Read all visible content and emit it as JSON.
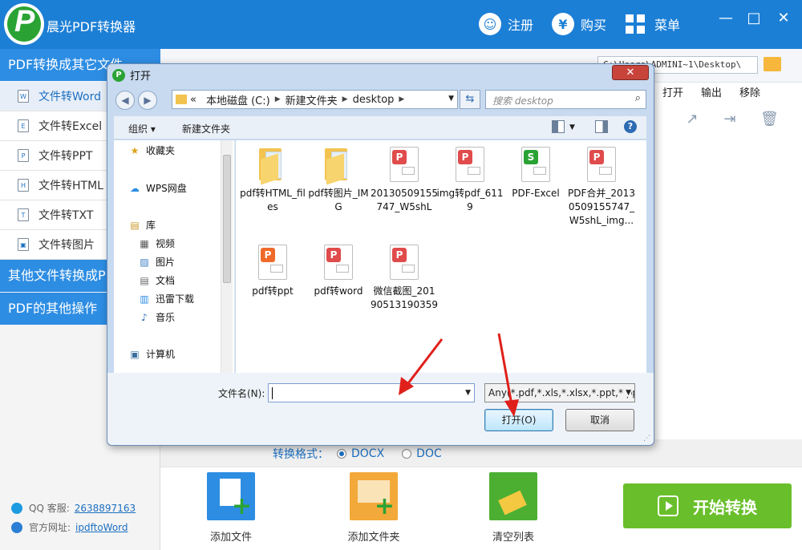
{
  "app": {
    "title": "晨光PDF转换器",
    "register": "注册",
    "buy": "购买",
    "menu": "菜单",
    "buy_symbol": "¥",
    "win_controls": [
      "—",
      "□",
      "✕"
    ]
  },
  "sidebar": {
    "section1": "PDF转换成其它文件",
    "items": [
      {
        "label": "文件转Word",
        "tag": "W",
        "active": true
      },
      {
        "label": "文件转Excel",
        "tag": "E"
      },
      {
        "label": "文件转PPT",
        "tag": "P"
      },
      {
        "label": "文件转HTML",
        "tag": "H"
      },
      {
        "label": "文件转TXT",
        "tag": "T"
      },
      {
        "label": "文件转图片",
        "tag": "▣"
      }
    ],
    "section2": "其他文件转换成PDF",
    "section3": "PDF的其他操作",
    "qq_label": "QQ 客服:",
    "qq_value": "2638897163",
    "site_label": "官方网址:",
    "site_value": "ipdftoWord"
  },
  "main": {
    "output_path": "C:\\Users\\ADMINI~1\\Desktop\\",
    "columns": [
      "打开",
      "输出",
      "移除"
    ],
    "format_label": "转换格式：",
    "formats": [
      {
        "label": "DOCX",
        "selected": true
      },
      {
        "label": "DOC",
        "selected": false
      }
    ],
    "tools": [
      "添加文件",
      "添加文件夹",
      "清空列表"
    ],
    "start_label": "开始转换"
  },
  "dialog": {
    "title": "打开",
    "close": "✕",
    "breadcrumb": [
      "«",
      "本地磁盘 (C:)",
      "新建文件夹",
      "desktop"
    ],
    "search_placeholder": "搜索 desktop",
    "organize": "组织 ▾",
    "new_folder": "新建文件夹",
    "nav": [
      {
        "label": "收藏夹",
        "icon": "★"
      },
      {
        "label": "WPS网盘",
        "icon": "☁"
      },
      {
        "label": "库",
        "icon": "▤"
      },
      {
        "label": "视频",
        "icon": "▦"
      },
      {
        "label": "图片",
        "icon": "▨"
      },
      {
        "label": "文档",
        "icon": "▤"
      },
      {
        "label": "迅雷下载",
        "icon": "▥"
      },
      {
        "label": "音乐",
        "icon": "♪"
      },
      {
        "label": "计算机",
        "icon": "▣"
      }
    ],
    "files": [
      {
        "name": "pdf转HTML_files",
        "kind": "folder"
      },
      {
        "name": "pdf转图片_IMG",
        "kind": "folder"
      },
      {
        "name": "20130509155747_W5shL",
        "kind": "pdf"
      },
      {
        "name": "img转pdf_6119",
        "kind": "pdf"
      },
      {
        "name": "PDF-Excel",
        "kind": "excel"
      },
      {
        "name": "PDF合并_20130509155747_W5shL_img...",
        "kind": "pdf"
      },
      {
        "name": "pdf转ppt",
        "kind": "ppt"
      },
      {
        "name": "pdf转word",
        "kind": "pdf"
      },
      {
        "name": "微信截图_20190513190359",
        "kind": "pdf"
      }
    ],
    "filename_label": "文件名(N):",
    "filename_value": "",
    "filetype": "Any(*.pdf,*.xls,*.xlsx,*.ppt,*.pp",
    "open_btn": "打开(O)",
    "cancel_btn": "取消"
  },
  "colors": {
    "accent": "#1c7fd6",
    "start_green": "#69bf2b",
    "annotation_red": "#e0201a"
  }
}
